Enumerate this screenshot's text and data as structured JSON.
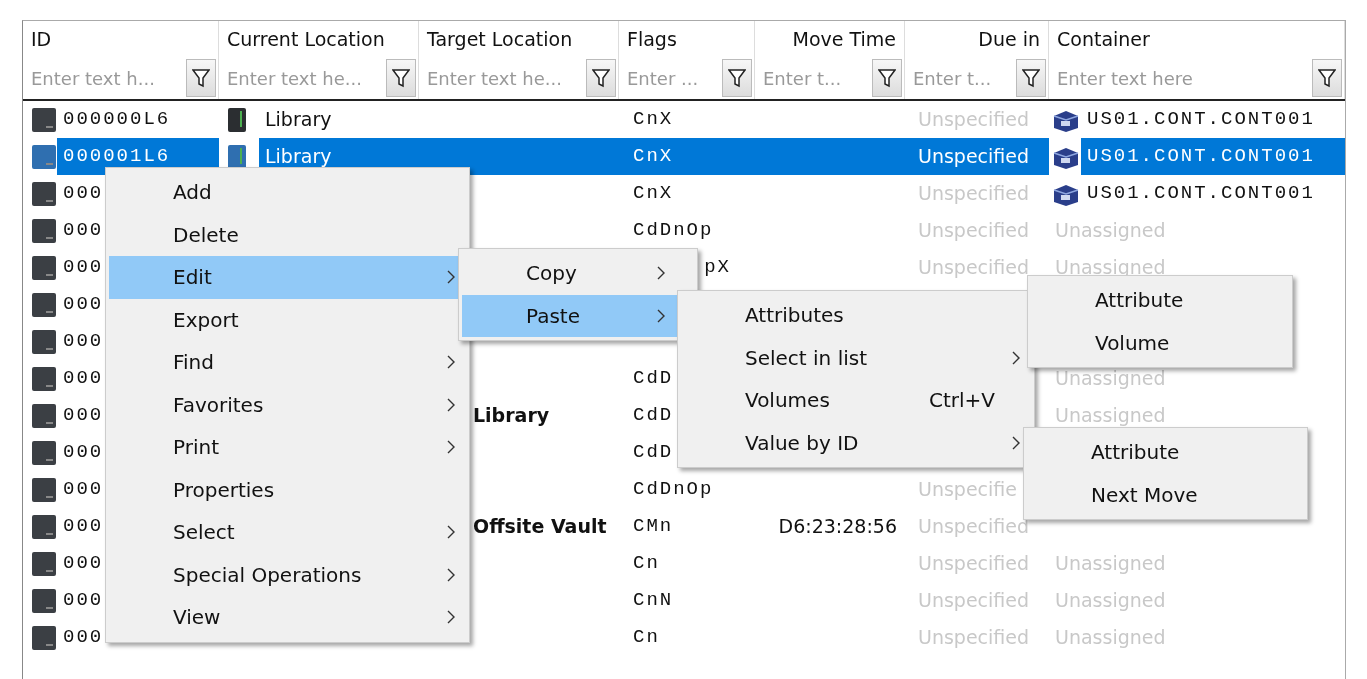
{
  "table": {
    "columns": [
      {
        "title": "ID",
        "placeholder": "Enter text h..."
      },
      {
        "title": "Current Location",
        "placeholder": "Enter text he..."
      },
      {
        "title": "Target Location",
        "placeholder": "Enter text he..."
      },
      {
        "title": "Flags",
        "placeholder": "Enter ..."
      },
      {
        "title": "Move Time",
        "placeholder": "Enter t..."
      },
      {
        "title": "Due in",
        "placeholder": "Enter t..."
      },
      {
        "title": "Container",
        "placeholder": "Enter text here"
      }
    ],
    "rows": [
      {
        "selected": false,
        "id": "000000L6",
        "current": "Library",
        "flags": "CnX",
        "due": "Unspecified",
        "container": {
          "text": "US01.CONT.CONT001",
          "assigned": true
        }
      },
      {
        "selected": true,
        "id": "000001L6",
        "current": "Library",
        "flags": "CnX",
        "due": "Unspecified",
        "container": {
          "text": "US01.CONT.CONT001",
          "assigned": true
        }
      },
      {
        "selected": false,
        "id": "000",
        "flags": "CnX",
        "due": "Unspecified",
        "container": {
          "text": "US01.CONT.CONT001",
          "assigned": true
        }
      },
      {
        "selected": false,
        "id": "000",
        "flags": "CdDnOp",
        "due": "Unspecified",
        "container": {
          "text": "Unassigned",
          "assigned": false
        }
      },
      {
        "selected": false,
        "id": "000",
        "flags": "pX",
        "flags_cut": true,
        "due": "Unspecified",
        "container": {
          "text": "Unassigned",
          "assigned": false
        }
      },
      {
        "selected": false,
        "id": "000"
      },
      {
        "selected": false,
        "id": "000"
      },
      {
        "selected": false,
        "id": "000",
        "flags": "CdD",
        "container": {
          "text": "Unassigned",
          "assigned": false
        }
      },
      {
        "selected": false,
        "id": "000",
        "target": "Library",
        "flags": "CdD",
        "container": {
          "text": "Unassigned",
          "assigned": false
        }
      },
      {
        "selected": false,
        "id": "000",
        "flags": "CdD"
      },
      {
        "selected": false,
        "id": "000",
        "flags": "CdDnOp",
        "due": "Unspecifie"
      },
      {
        "selected": false,
        "id": "000",
        "target": "Offsite Vault",
        "flags": "CMn",
        "move_time": "D6:23:28:56",
        "due": "Unspecified"
      },
      {
        "selected": false,
        "id": "000",
        "flags": "Cn",
        "due": "Unspecified",
        "container": {
          "text": "Unassigned",
          "assigned": false
        }
      },
      {
        "selected": false,
        "id": "000",
        "flags": "CnN",
        "due": "Unspecified",
        "container": {
          "text": "Unassigned",
          "assigned": false
        }
      },
      {
        "selected": false,
        "id": "000",
        "flags": "Cn",
        "due": "Unspecified",
        "container": {
          "text": "Unassigned",
          "assigned": false
        }
      }
    ]
  },
  "context_menu": {
    "items": [
      {
        "label": "Add",
        "submenu": false,
        "selected": false
      },
      {
        "label": "Delete",
        "submenu": false,
        "selected": false
      },
      {
        "label": "Edit",
        "submenu": true,
        "selected": true,
        "children": [
          {
            "label": "Copy",
            "submenu": true,
            "selected": false
          },
          {
            "label": "Paste",
            "submenu": true,
            "selected": true,
            "children": [
              {
                "label": "Attributes",
                "submenu": false,
                "selected": false
              },
              {
                "label": "Select in list",
                "submenu": true,
                "selected": false,
                "children": [
                  {
                    "label": "Attribute",
                    "submenu": false,
                    "selected": false
                  },
                  {
                    "label": "Volume",
                    "submenu": false,
                    "selected": false
                  }
                ]
              },
              {
                "label": "Volumes",
                "shortcut": "Ctrl+V",
                "submenu": false,
                "selected": false
              },
              {
                "label": "Value by ID",
                "submenu": true,
                "selected": false,
                "children": [
                  {
                    "label": "Attribute",
                    "submenu": false,
                    "selected": false
                  },
                  {
                    "label": "Next Move",
                    "submenu": false,
                    "selected": false
                  }
                ]
              }
            ]
          }
        ]
      },
      {
        "label": "Export",
        "submenu": false,
        "selected": false
      },
      {
        "label": "Find",
        "submenu": true,
        "selected": false
      },
      {
        "label": "Favorites",
        "submenu": true,
        "selected": false
      },
      {
        "label": "Print",
        "submenu": true,
        "selected": false
      },
      {
        "label": "Properties",
        "submenu": false,
        "selected": false
      },
      {
        "label": "Select",
        "submenu": true,
        "selected": false
      },
      {
        "label": "Special Operations",
        "submenu": true,
        "selected": false
      },
      {
        "label": "View",
        "submenu": true,
        "selected": false
      }
    ]
  }
}
